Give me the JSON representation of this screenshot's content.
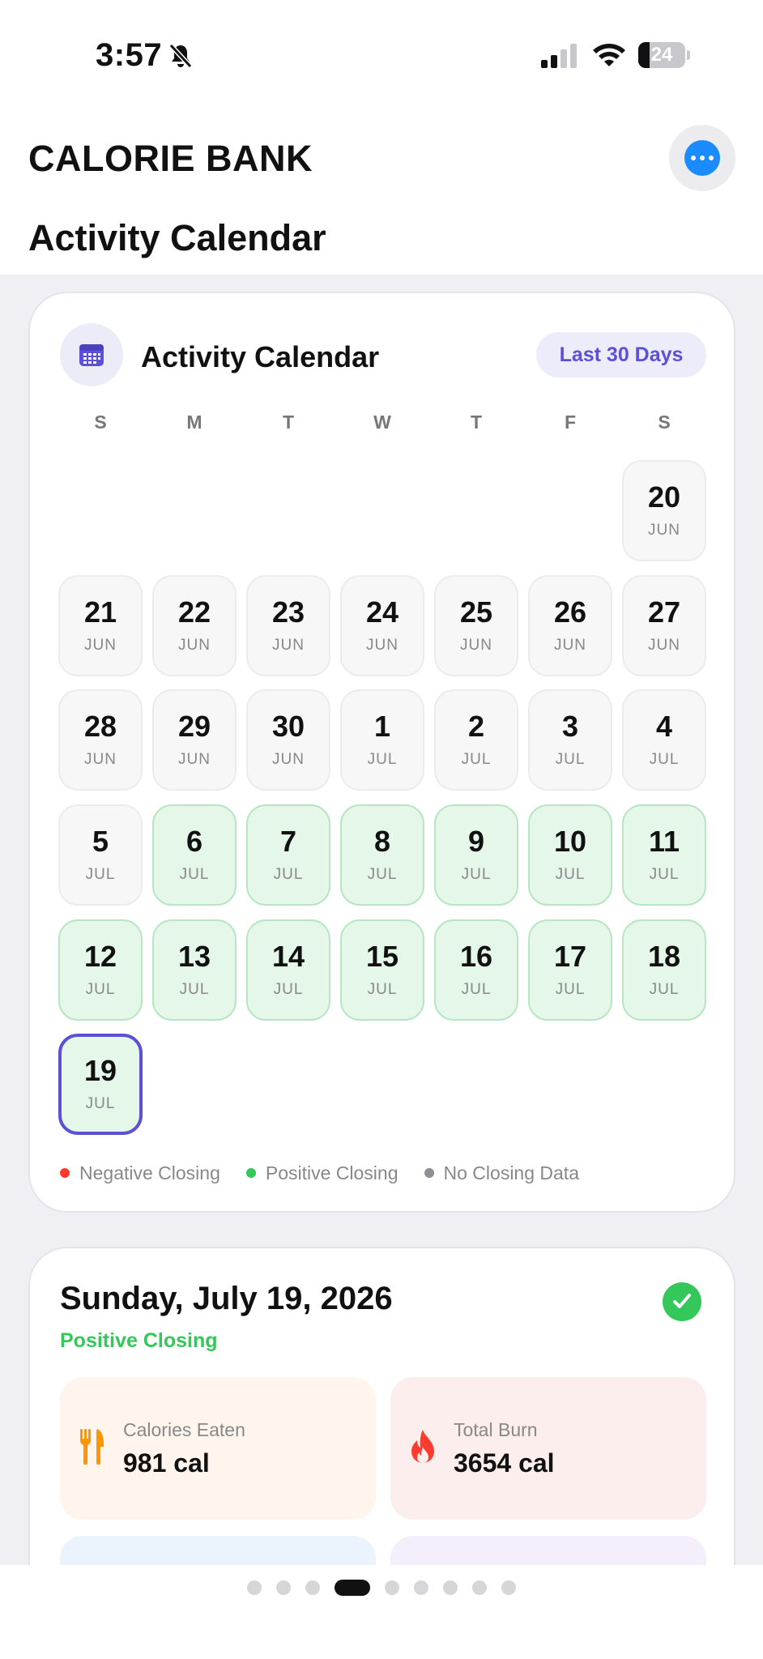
{
  "status_bar": {
    "time": "3:57",
    "battery": "24",
    "battery_level": 0.24
  },
  "header": {
    "app_title": "CALORIE BANK",
    "page_title": "Activity Calendar"
  },
  "calendar": {
    "title": "Activity Calendar",
    "range_label": "Last 30 Days",
    "weekdays": [
      "S",
      "M",
      "T",
      "W",
      "T",
      "F",
      "S"
    ],
    "days": [
      {
        "day": "20",
        "month": "JUN",
        "status": "none"
      },
      {
        "day": "21",
        "month": "JUN",
        "status": "none"
      },
      {
        "day": "22",
        "month": "JUN",
        "status": "none"
      },
      {
        "day": "23",
        "month": "JUN",
        "status": "none"
      },
      {
        "day": "24",
        "month": "JUN",
        "status": "none"
      },
      {
        "day": "25",
        "month": "JUN",
        "status": "none"
      },
      {
        "day": "26",
        "month": "JUN",
        "status": "none"
      },
      {
        "day": "27",
        "month": "JUN",
        "status": "none"
      },
      {
        "day": "28",
        "month": "JUN",
        "status": "none"
      },
      {
        "day": "29",
        "month": "JUN",
        "status": "none"
      },
      {
        "day": "30",
        "month": "JUN",
        "status": "none"
      },
      {
        "day": "1",
        "month": "JUL",
        "status": "none"
      },
      {
        "day": "2",
        "month": "JUL",
        "status": "none"
      },
      {
        "day": "3",
        "month": "JUL",
        "status": "none"
      },
      {
        "day": "4",
        "month": "JUL",
        "status": "none"
      },
      {
        "day": "5",
        "month": "JUL",
        "status": "none"
      },
      {
        "day": "6",
        "month": "JUL",
        "status": "positive"
      },
      {
        "day": "7",
        "month": "JUL",
        "status": "positive"
      },
      {
        "day": "8",
        "month": "JUL",
        "status": "positive"
      },
      {
        "day": "9",
        "month": "JUL",
        "status": "positive"
      },
      {
        "day": "10",
        "month": "JUL",
        "status": "positive"
      },
      {
        "day": "11",
        "month": "JUL",
        "status": "positive"
      },
      {
        "day": "12",
        "month": "JUL",
        "status": "positive"
      },
      {
        "day": "13",
        "month": "JUL",
        "status": "positive"
      },
      {
        "day": "14",
        "month": "JUL",
        "status": "positive"
      },
      {
        "day": "15",
        "month": "JUL",
        "status": "positive"
      },
      {
        "day": "16",
        "month": "JUL",
        "status": "positive"
      },
      {
        "day": "17",
        "month": "JUL",
        "status": "positive"
      },
      {
        "day": "18",
        "month": "JUL",
        "status": "positive"
      },
      {
        "day": "19",
        "month": "JUL",
        "status": "positive",
        "selected": true
      }
    ],
    "legend": [
      {
        "label": "Negative Closing",
        "color": "#ff3b30"
      },
      {
        "label": "Positive Closing",
        "color": "#34c759"
      },
      {
        "label": "No Closing Data",
        "color": "#8e8e93"
      }
    ]
  },
  "day_detail": {
    "date": "Sunday, July 19, 2026",
    "status": "Positive Closing",
    "stats": [
      {
        "label": "Calories Eaten",
        "value": "981 cal",
        "icon": "fork-knife-icon",
        "color": "#ff9500"
      },
      {
        "label": "Total Burn",
        "value": "3654 cal",
        "icon": "flame-icon",
        "color": "#ff3b30"
      }
    ]
  },
  "pager": {
    "count": 9,
    "active_index": 3
  }
}
